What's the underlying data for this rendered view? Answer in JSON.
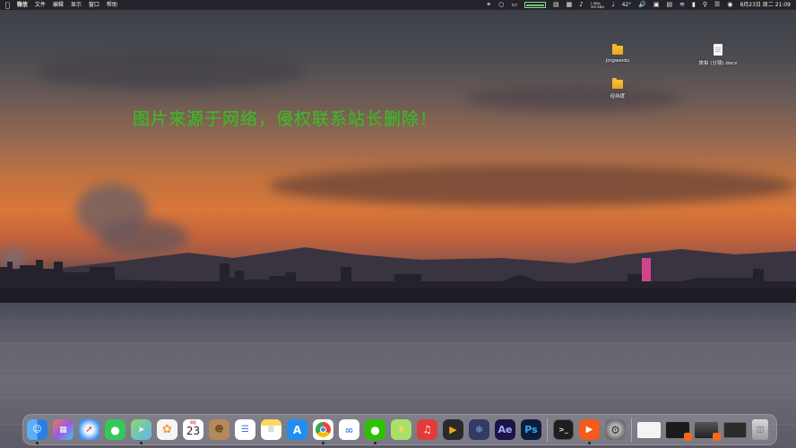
{
  "menubar": {
    "apple_icon": "apple-icon",
    "app_name": "微信",
    "menus": [
      "文件",
      "编辑",
      "显示",
      "窗口",
      "帮助"
    ],
    "status": {
      "network_up": "1 KB/s",
      "network_down": "355 KB/s",
      "temperature": "42°",
      "datetime": "8月23日 周二  21:09"
    }
  },
  "desktop": {
    "icons": [
      {
        "label": "jingweidu",
        "kind": "folder"
      },
      {
        "label": "经纬度",
        "kind": "folder"
      },
      {
        "label": "旅拍 (分镜).docx",
        "kind": "document"
      }
    ],
    "watermark": "图片来源于网络，侵权联系站长删除！"
  },
  "dock": {
    "apps": [
      {
        "name": "finder",
        "color": "#2c8ff0"
      },
      {
        "name": "launchpad",
        "color": "#e96a5a"
      },
      {
        "name": "safari",
        "color": "#3a8ff3"
      },
      {
        "name": "messages",
        "color": "#34c759"
      },
      {
        "name": "maps",
        "color": "#5bb9f5"
      },
      {
        "name": "photos",
        "color": "#f5f5f5"
      },
      {
        "name": "calendar",
        "color": "#ffffff"
      },
      {
        "name": "contacts",
        "color": "#b58a5a"
      },
      {
        "name": "reminders",
        "color": "#ffffff"
      },
      {
        "name": "notes",
        "color": "#fbd75b"
      },
      {
        "name": "app-store",
        "color": "#1f8ff4"
      },
      {
        "name": "chrome",
        "color": "#ffffff"
      },
      {
        "name": "baidu-netdisk",
        "color": "#ffffff"
      },
      {
        "name": "wechat",
        "color": "#2dc100"
      },
      {
        "name": "fenqu",
        "color": "#a8e06a"
      },
      {
        "name": "netease-music",
        "color": "#e33a3a"
      },
      {
        "name": "final-cut-pro",
        "color": "#2a2a2a"
      },
      {
        "name": "davinci-resolve",
        "color": "#333a66"
      },
      {
        "name": "after-effects",
        "color": "#1a1447"
      },
      {
        "name": "photoshop",
        "color": "#0b1d3a"
      },
      {
        "name": "terminal",
        "color": "#1e1e1e"
      },
      {
        "name": "live-app",
        "color": "#f45b1c"
      },
      {
        "name": "system-preferences",
        "color": "#8e8e93"
      }
    ],
    "calendar_month": "8月",
    "calendar_day": "23",
    "ae_label": "Ae",
    "ps_label": "Ps"
  }
}
